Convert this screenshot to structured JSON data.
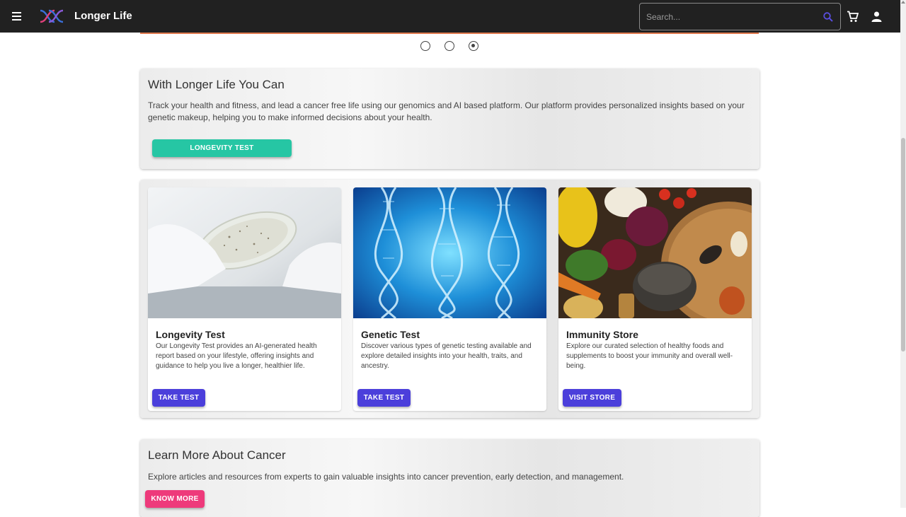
{
  "app": {
    "title": "Longer Life",
    "search_placeholder": "Search...",
    "accent": "#5a4ee0"
  },
  "carousel": {
    "slides": 3,
    "active_index": 2
  },
  "intro": {
    "heading": "With Longer Life You Can",
    "text": "Track your health and fitness, and lead a cancer free life using our genomics and AI based platform. Our platform provides personalized insights based on your genetic makeup, helping you to make informed decisions about your health.",
    "button_label": "LONGEVITY TEST",
    "button_color": "#26c6a4"
  },
  "cards": [
    {
      "title": "Longevity Test",
      "description": "Our Longevity Test provides an AI-generated health report based on your lifestyle, offering insights and guidance to help you live a longer, healthier life.",
      "button_label": "TAKE TEST",
      "image": "petri-dish-lab-photo"
    },
    {
      "title": "Genetic Test",
      "description": "Discover various types of genetic testing available and explore detailed insights into your health, traits, and ancestry.",
      "button_label": "TAKE TEST",
      "image": "dna-helix-blue-photo"
    },
    {
      "title": "Immunity Store",
      "description": "Explore our curated selection of healthy foods and supplements to boost your immunity and overall well-being.",
      "button_label": "VISIT STORE",
      "image": "vegetables-spices-photo"
    }
  ],
  "learn_more": {
    "heading": "Learn More About Cancer",
    "text": "Explore articles and resources from experts to gain valuable insights into cancer prevention, early detection, and management.",
    "button_label": "KNOW MORE",
    "button_color": "#ee3a7b"
  },
  "colors": {
    "appbar": "#212121",
    "primary_button": "#4b3fdb"
  }
}
